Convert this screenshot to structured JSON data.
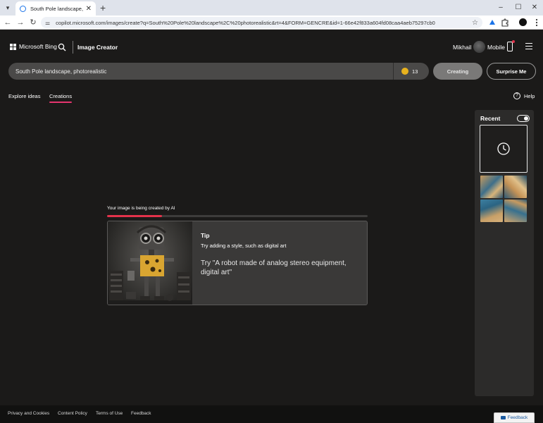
{
  "browser": {
    "tab_title": "South Pole landscape, photore",
    "url": "copilot.microsoft.com/images/create?q=South%20Pole%20landscape%2C%20photorealistic&rt=4&FORM=GENCRE&id=1-66e42f833a604fd08caa4aeb75297cb0",
    "new_tab_icon": "+",
    "tab_close_icon": "✕",
    "minimize_icon": "–",
    "maximize_icon": "☐",
    "close_icon": "✕",
    "back_icon": "←",
    "forward_icon": "→",
    "reload_icon": "↻",
    "tune_icon": "⚌",
    "star_icon": "☆"
  },
  "header": {
    "brand": "Microsoft Bing",
    "title": "Image Creator",
    "user_name": "Mikhail",
    "mobile_label": "Mobile"
  },
  "prompt": {
    "value": "South Pole landscape, photorealistic",
    "boosts": "13",
    "creating_label": "Creating",
    "surprise_label": "Surprise Me"
  },
  "tabs": {
    "explore": "Explore ideas",
    "creations": "Creations",
    "help": "Help"
  },
  "creation": {
    "status": "Your image is being created by AI",
    "progress": 0.21,
    "tip_heading": "Tip",
    "tip_sub": "Try adding a style, such as digital art",
    "tip_example": "Try \"A robot made of analog stereo equipment, digital art\""
  },
  "recent": {
    "title": "Recent",
    "toggle_on": true
  },
  "footer": {
    "privacy": "Privacy and Cookies",
    "content_policy": "Content Policy",
    "terms": "Terms of Use",
    "feedback": "Feedback",
    "feedback_button": "Feedback"
  },
  "colors": {
    "accent": "#e5356f",
    "progress": "#e3324b",
    "coin": "#e8b21e",
    "background": "#1b1a19"
  }
}
